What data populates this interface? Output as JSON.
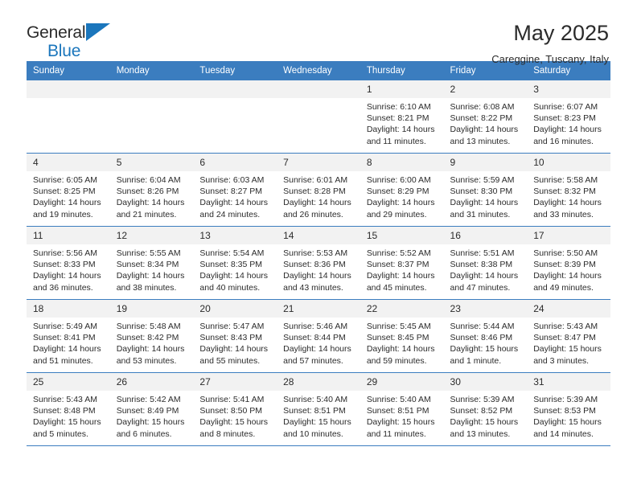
{
  "brand": {
    "name_part1": "General",
    "name_part2": "Blue",
    "accent_color": "#1b76bc"
  },
  "header": {
    "title": "May 2025",
    "location": "Careggine, Tuscany, Italy"
  },
  "calendar": {
    "header_bg": "#3b7dbf",
    "daynum_bg": "#f2f2f2",
    "weekday_headers": [
      "Sunday",
      "Monday",
      "Tuesday",
      "Wednesday",
      "Thursday",
      "Friday",
      "Saturday"
    ],
    "weeks": [
      [
        {
          "day": "",
          "sunrise": "",
          "sunset": "",
          "daylight": ""
        },
        {
          "day": "",
          "sunrise": "",
          "sunset": "",
          "daylight": ""
        },
        {
          "day": "",
          "sunrise": "",
          "sunset": "",
          "daylight": ""
        },
        {
          "day": "",
          "sunrise": "",
          "sunset": "",
          "daylight": ""
        },
        {
          "day": "1",
          "sunrise": "Sunrise: 6:10 AM",
          "sunset": "Sunset: 8:21 PM",
          "daylight": "Daylight: 14 hours and 11 minutes."
        },
        {
          "day": "2",
          "sunrise": "Sunrise: 6:08 AM",
          "sunset": "Sunset: 8:22 PM",
          "daylight": "Daylight: 14 hours and 13 minutes."
        },
        {
          "day": "3",
          "sunrise": "Sunrise: 6:07 AM",
          "sunset": "Sunset: 8:23 PM",
          "daylight": "Daylight: 14 hours and 16 minutes."
        }
      ],
      [
        {
          "day": "4",
          "sunrise": "Sunrise: 6:05 AM",
          "sunset": "Sunset: 8:25 PM",
          "daylight": "Daylight: 14 hours and 19 minutes."
        },
        {
          "day": "5",
          "sunrise": "Sunrise: 6:04 AM",
          "sunset": "Sunset: 8:26 PM",
          "daylight": "Daylight: 14 hours and 21 minutes."
        },
        {
          "day": "6",
          "sunrise": "Sunrise: 6:03 AM",
          "sunset": "Sunset: 8:27 PM",
          "daylight": "Daylight: 14 hours and 24 minutes."
        },
        {
          "day": "7",
          "sunrise": "Sunrise: 6:01 AM",
          "sunset": "Sunset: 8:28 PM",
          "daylight": "Daylight: 14 hours and 26 minutes."
        },
        {
          "day": "8",
          "sunrise": "Sunrise: 6:00 AM",
          "sunset": "Sunset: 8:29 PM",
          "daylight": "Daylight: 14 hours and 29 minutes."
        },
        {
          "day": "9",
          "sunrise": "Sunrise: 5:59 AM",
          "sunset": "Sunset: 8:30 PM",
          "daylight": "Daylight: 14 hours and 31 minutes."
        },
        {
          "day": "10",
          "sunrise": "Sunrise: 5:58 AM",
          "sunset": "Sunset: 8:32 PM",
          "daylight": "Daylight: 14 hours and 33 minutes."
        }
      ],
      [
        {
          "day": "11",
          "sunrise": "Sunrise: 5:56 AM",
          "sunset": "Sunset: 8:33 PM",
          "daylight": "Daylight: 14 hours and 36 minutes."
        },
        {
          "day": "12",
          "sunrise": "Sunrise: 5:55 AM",
          "sunset": "Sunset: 8:34 PM",
          "daylight": "Daylight: 14 hours and 38 minutes."
        },
        {
          "day": "13",
          "sunrise": "Sunrise: 5:54 AM",
          "sunset": "Sunset: 8:35 PM",
          "daylight": "Daylight: 14 hours and 40 minutes."
        },
        {
          "day": "14",
          "sunrise": "Sunrise: 5:53 AM",
          "sunset": "Sunset: 8:36 PM",
          "daylight": "Daylight: 14 hours and 43 minutes."
        },
        {
          "day": "15",
          "sunrise": "Sunrise: 5:52 AM",
          "sunset": "Sunset: 8:37 PM",
          "daylight": "Daylight: 14 hours and 45 minutes."
        },
        {
          "day": "16",
          "sunrise": "Sunrise: 5:51 AM",
          "sunset": "Sunset: 8:38 PM",
          "daylight": "Daylight: 14 hours and 47 minutes."
        },
        {
          "day": "17",
          "sunrise": "Sunrise: 5:50 AM",
          "sunset": "Sunset: 8:39 PM",
          "daylight": "Daylight: 14 hours and 49 minutes."
        }
      ],
      [
        {
          "day": "18",
          "sunrise": "Sunrise: 5:49 AM",
          "sunset": "Sunset: 8:41 PM",
          "daylight": "Daylight: 14 hours and 51 minutes."
        },
        {
          "day": "19",
          "sunrise": "Sunrise: 5:48 AM",
          "sunset": "Sunset: 8:42 PM",
          "daylight": "Daylight: 14 hours and 53 minutes."
        },
        {
          "day": "20",
          "sunrise": "Sunrise: 5:47 AM",
          "sunset": "Sunset: 8:43 PM",
          "daylight": "Daylight: 14 hours and 55 minutes."
        },
        {
          "day": "21",
          "sunrise": "Sunrise: 5:46 AM",
          "sunset": "Sunset: 8:44 PM",
          "daylight": "Daylight: 14 hours and 57 minutes."
        },
        {
          "day": "22",
          "sunrise": "Sunrise: 5:45 AM",
          "sunset": "Sunset: 8:45 PM",
          "daylight": "Daylight: 14 hours and 59 minutes."
        },
        {
          "day": "23",
          "sunrise": "Sunrise: 5:44 AM",
          "sunset": "Sunset: 8:46 PM",
          "daylight": "Daylight: 15 hours and 1 minute."
        },
        {
          "day": "24",
          "sunrise": "Sunrise: 5:43 AM",
          "sunset": "Sunset: 8:47 PM",
          "daylight": "Daylight: 15 hours and 3 minutes."
        }
      ],
      [
        {
          "day": "25",
          "sunrise": "Sunrise: 5:43 AM",
          "sunset": "Sunset: 8:48 PM",
          "daylight": "Daylight: 15 hours and 5 minutes."
        },
        {
          "day": "26",
          "sunrise": "Sunrise: 5:42 AM",
          "sunset": "Sunset: 8:49 PM",
          "daylight": "Daylight: 15 hours and 6 minutes."
        },
        {
          "day": "27",
          "sunrise": "Sunrise: 5:41 AM",
          "sunset": "Sunset: 8:50 PM",
          "daylight": "Daylight: 15 hours and 8 minutes."
        },
        {
          "day": "28",
          "sunrise": "Sunrise: 5:40 AM",
          "sunset": "Sunset: 8:51 PM",
          "daylight": "Daylight: 15 hours and 10 minutes."
        },
        {
          "day": "29",
          "sunrise": "Sunrise: 5:40 AM",
          "sunset": "Sunset: 8:51 PM",
          "daylight": "Daylight: 15 hours and 11 minutes."
        },
        {
          "day": "30",
          "sunrise": "Sunrise: 5:39 AM",
          "sunset": "Sunset: 8:52 PM",
          "daylight": "Daylight: 15 hours and 13 minutes."
        },
        {
          "day": "31",
          "sunrise": "Sunrise: 5:39 AM",
          "sunset": "Sunset: 8:53 PM",
          "daylight": "Daylight: 15 hours and 14 minutes."
        }
      ]
    ]
  }
}
